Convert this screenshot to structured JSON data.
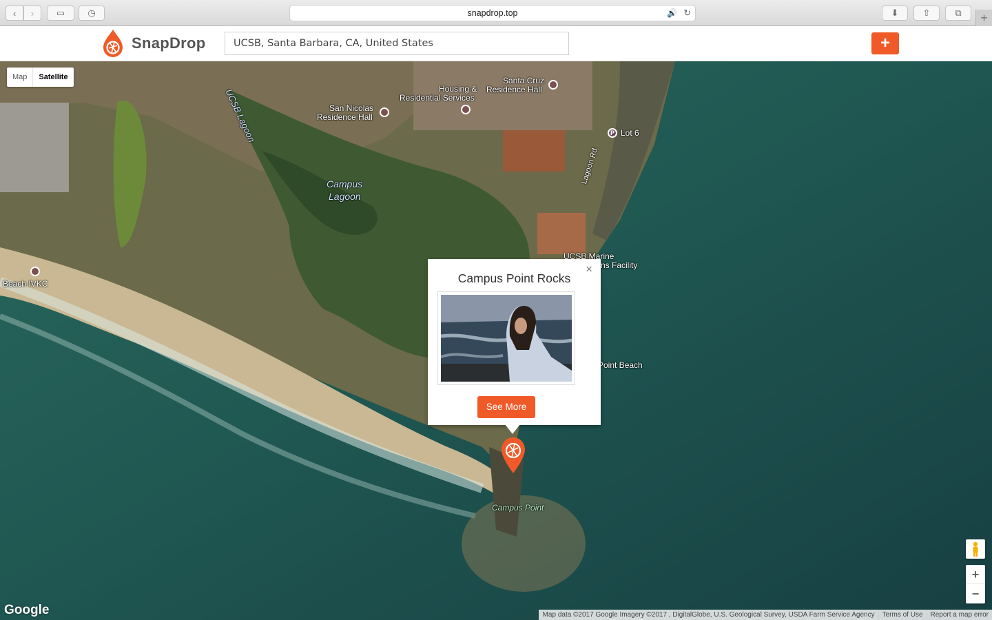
{
  "browser": {
    "url": "snapdrop.top",
    "back_icon": "‹",
    "forward_icon": "›",
    "sidebar_icon": "▭",
    "history_icon": "◷",
    "download_icon": "⬇",
    "share_icon": "⇧",
    "tabs_icon": "⧉",
    "new_tab_icon": "+",
    "audio_icon": "🔊",
    "reload_icon": "↻"
  },
  "header": {
    "brand": "SnapDrop",
    "search_value": "UCSB, Santa Barbara, CA, United States",
    "add_icon": "+"
  },
  "map": {
    "type_options": [
      "Map",
      "Satellite"
    ],
    "selected_type": "Satellite",
    "labels": {
      "ucsb_lagoon": "UCSB Lagoon",
      "campus_lagoon_1": "Campus",
      "campus_lagoon_2": "Lagoon",
      "housing_1": "Housing &",
      "housing_2": "Residential Services",
      "santa_cruz_1": "Santa Cruz",
      "santa_cruz_2": "Residence Hall",
      "san_nicolas_1": "San Nicolas",
      "san_nicolas_2": "Residence Hall",
      "lot6": "Lot 6",
      "lagoon_rd": "Lagoon Rd",
      "marine_1": "UCSB Marine",
      "marine_2": "ns Facility",
      "beach_ivkc": "Beach IVKC",
      "point_beach": "Point Beach",
      "campus_point": "Campus Point"
    },
    "parking_icon": "P",
    "zoom_in": "+",
    "zoom_out": "−",
    "google_logo": "Google",
    "attribution": {
      "data": "Map data ©2017 Google Imagery ©2017 , DigitalGlobe, U.S. Geological Survey, USDA Farm Service Agency",
      "terms": "Terms of Use",
      "report": "Report a map error"
    }
  },
  "popup": {
    "title": "Campus Point Rocks",
    "close": "×",
    "button": "See More"
  },
  "colors": {
    "brand": "#f05a28",
    "ocean": "#1d4f4c"
  }
}
